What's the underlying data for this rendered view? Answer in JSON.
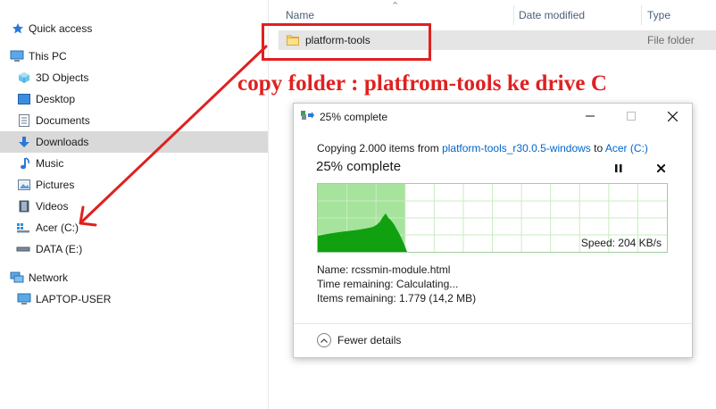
{
  "sidebar": {
    "items": [
      {
        "label": "Quick access",
        "icon": "star-icon"
      },
      {
        "label": "This PC",
        "icon": "computer-icon"
      },
      {
        "label": "3D Objects",
        "icon": "cube-icon"
      },
      {
        "label": "Desktop",
        "icon": "desktop-icon"
      },
      {
        "label": "Documents",
        "icon": "document-icon"
      },
      {
        "label": "Downloads",
        "icon": "download-arrow-icon"
      },
      {
        "label": "Music",
        "icon": "music-note-icon"
      },
      {
        "label": "Pictures",
        "icon": "picture-icon"
      },
      {
        "label": "Videos",
        "icon": "film-icon"
      },
      {
        "label": "Acer (C:)",
        "icon": "windows-drive-icon"
      },
      {
        "label": "DATA (E:)",
        "icon": "drive-icon"
      },
      {
        "label": "Network",
        "icon": "network-icon"
      },
      {
        "label": "LAPTOP-USER",
        "icon": "monitor-icon"
      }
    ],
    "selected": "Downloads"
  },
  "file_list": {
    "columns": {
      "name": "Name",
      "date": "Date modified",
      "type": "Type"
    },
    "rows": [
      {
        "name": "platform-tools",
        "type": "File folder"
      }
    ]
  },
  "annotation": {
    "text": "copy folder : platfrom-tools ke drive C",
    "color": "#e02020"
  },
  "dialog": {
    "title": "25% complete",
    "copy_prefix": "Copying 2.000 items from ",
    "source": "platform-tools_r30.0.5-windows",
    "copy_to": " to ",
    "destination": "Acer (C:)",
    "status": "25% complete",
    "progress_percent": 25,
    "speed": "Speed: 204 KB/s",
    "name_line": "Name:  rcssmin-module.html",
    "time_line": "Time remaining:  Calculating...",
    "items_line": "Items remaining:  1.779 (14,2 MB)",
    "fewer_details": "Fewer details",
    "colors": {
      "progress_fill": "#a6e39c",
      "graph_fill": "#10a010",
      "link": "#0066cc"
    }
  }
}
